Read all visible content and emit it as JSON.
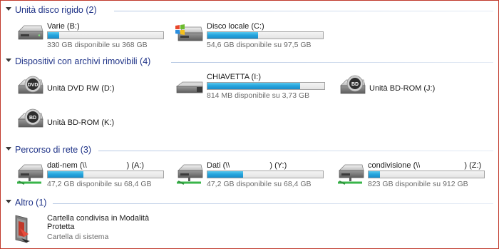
{
  "groups": {
    "hdd": {
      "title": "Unità disco rigido (2)"
    },
    "removable": {
      "title": "Dispositivi con archivi rimovibili (4)"
    },
    "network": {
      "title": "Percorso di rete (3)"
    },
    "other": {
      "title": "Altro (1)"
    }
  },
  "drives": {
    "varie": {
      "name": "Varie (B:)",
      "free_text": "330 GB disponibile su 368 GB",
      "used_fraction": 0.1,
      "icon": "hard-drive-icon"
    },
    "disco_locale": {
      "name": "Disco locale (C:)",
      "free_text": "54,6 GB disponibile su 97,5 GB",
      "used_fraction": 0.44,
      "icon": "windows-drive-icon"
    },
    "dvd": {
      "name": "Unità DVD RW (D:)",
      "icon": "dvd-drive-icon",
      "badge": "DVD"
    },
    "chiavetta": {
      "name": "CHIAVETTA (I:)",
      "free_text": "814 MB disponibile su 3,73 GB",
      "used_fraction": 0.79,
      "icon": "usb-drive-icon"
    },
    "bd_j": {
      "name": "Unità BD-ROM (J:)",
      "icon": "bd-drive-icon",
      "badge": "BD"
    },
    "bd_k": {
      "name": "Unità BD-ROM (K:)",
      "icon": "bd-drive-icon",
      "badge": "BD"
    }
  },
  "network": {
    "dati_nem": {
      "name_prefix": "dati-nem (\\\\",
      "name_suffix": ") (A:)",
      "free_text": "47,2 GB disponibile su 68,4 GB",
      "used_fraction": 0.31,
      "icon": "network-drive-icon"
    },
    "dati": {
      "name_prefix": "Dati (\\\\",
      "name_suffix": ") (Y:)",
      "free_text": "47,2 GB disponibile su 68,4 GB",
      "used_fraction": 0.31,
      "icon": "network-drive-icon"
    },
    "condivisione": {
      "name_prefix": "condivisione (\\\\",
      "name_suffix": ") (Z:)",
      "free_text": "823 GB disponibile su 912 GB",
      "used_fraction": 0.1,
      "icon": "network-drive-icon"
    }
  },
  "other": {
    "cartella": {
      "name_line1": "Cartella condivisa in Modalità",
      "name_line2": "Protetta",
      "subtitle": "Cartella di sistema",
      "icon": "protected-folder-icon"
    }
  },
  "colors": {
    "header_text": "#1e3287",
    "bar_fill": "#27a6de"
  }
}
